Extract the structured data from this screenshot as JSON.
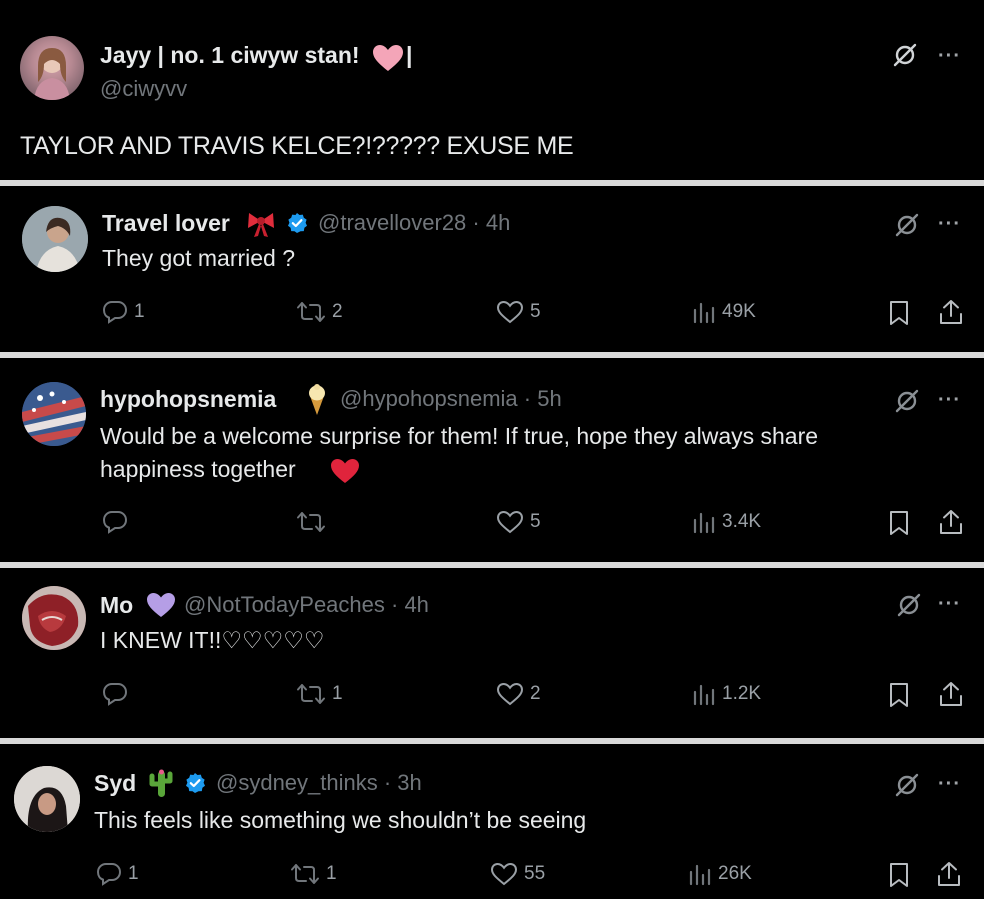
{
  "main_post": {
    "name": "Jayy | no. 1 ciwyw stan!",
    "name_suffix": "|",
    "handle": "@ciwyvv",
    "text": "TAYLOR AND TRAVIS KELCE?!????? EXUSE ME",
    "more": "···"
  },
  "replies": [
    {
      "name": "Travel lover",
      "handle": "@travellover28 · 4h",
      "text": "They got married ?",
      "replies": "1",
      "reposts": "2",
      "likes": "5",
      "views": "49K",
      "more": "···"
    },
    {
      "name": "hypohopsnemia",
      "handle": "@hypohopsnemia · 5h",
      "text_line1": "Would be a welcome surprise for them! If true, hope they always share",
      "text_line2": "happiness together",
      "replies": "",
      "reposts": "",
      "likes": "5",
      "views": "3.4K",
      "more": "···"
    },
    {
      "name": "Mo",
      "handle": "@NotTodayPeaches · 4h",
      "text": "I KNEW IT!!♡♡♡♡♡",
      "replies": "",
      "reposts": "1",
      "likes": "2",
      "views": "1.2K",
      "more": "···"
    },
    {
      "name": "Syd",
      "handle": "@sydney_thinks · 3h",
      "text": "This feels like something we shouldn’t be seeing",
      "replies": "1",
      "reposts": "1",
      "likes": "55",
      "views": "26K",
      "more": "···"
    }
  ],
  "colors": {
    "background": "#000000",
    "divider": "#d9d9d9",
    "text": "#e7e9ea",
    "muted": "#71767b",
    "verified": "#1d9bf0"
  },
  "icons": [
    "reply-icon",
    "repost-icon",
    "like-icon",
    "views-icon",
    "bookmark-icon",
    "share-icon",
    "grok-icon",
    "more-icon",
    "verified-icon",
    "heart-emoji",
    "bow-emoji",
    "ice-cream-emoji",
    "purple-heart-emoji",
    "cactus-emoji"
  ]
}
